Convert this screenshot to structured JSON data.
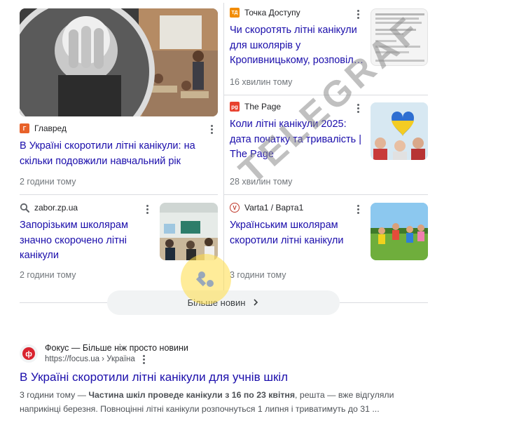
{
  "news": {
    "cards": [
      {
        "source": "Главред",
        "title_lines": [
          "В Україні скоротили літні канікули: на",
          "скільки подовжили навчальний рік"
        ],
        "time": "2 години тому",
        "favicon_color": "#e8622a",
        "favicon_glyph": "Г"
      },
      {
        "source": "Точка Доступу",
        "title_lines": [
          "Чи скоротять літні канікули",
          "для школярів у",
          "Кропивницькому, розповіл…"
        ],
        "time": "16 хвилин тому",
        "favicon_color": "#f28c00",
        "favicon_glyph": "ТД"
      },
      {
        "source": "The Page",
        "title_lines": [
          "Коли літні канікули 2025:",
          "дата початку та тривалість |",
          "The Page"
        ],
        "time": "28 хвилин тому",
        "favicon_color": "#e8412e",
        "favicon_glyph": "pg"
      },
      {
        "source": "zabor.zp.ua",
        "title_lines": [
          "Запорізьким школярам",
          "значно скорочено літні",
          "канікули"
        ],
        "time": "2 години тому",
        "favicon_color": "#5f6368",
        "favicon_glyph": "search-icon"
      },
      {
        "source": "Varta1 / Варта1",
        "title_lines": [
          "Українським школярам",
          "скоротили літні канікули"
        ],
        "time": "3 години тому",
        "favicon_color": "#c0392b",
        "favicon_glyph": "V"
      }
    ],
    "more_button_label": "Більше новин"
  },
  "watermark": "TELEGRAF",
  "web_result": {
    "site_name": "Фокус — Більше ніж просто новини",
    "url": "https://focus.ua › Україна",
    "title": "В Україні скоротили літні канікули для учнів шкіл",
    "snippet_time": "3 години тому",
    "snippet_dash": " — ",
    "snippet_bold": "Частина шкіл проведе канікули з 16 по 23 квітня",
    "snippet_rest": ", решта — вже відгуляли наприкінці березня. Повноцінні літні канікули розпочнуться 1 липня і триватимуть до 31 ..."
  },
  "colors": {
    "link": "#1a0dab",
    "focus_brand": "#d9232e"
  }
}
